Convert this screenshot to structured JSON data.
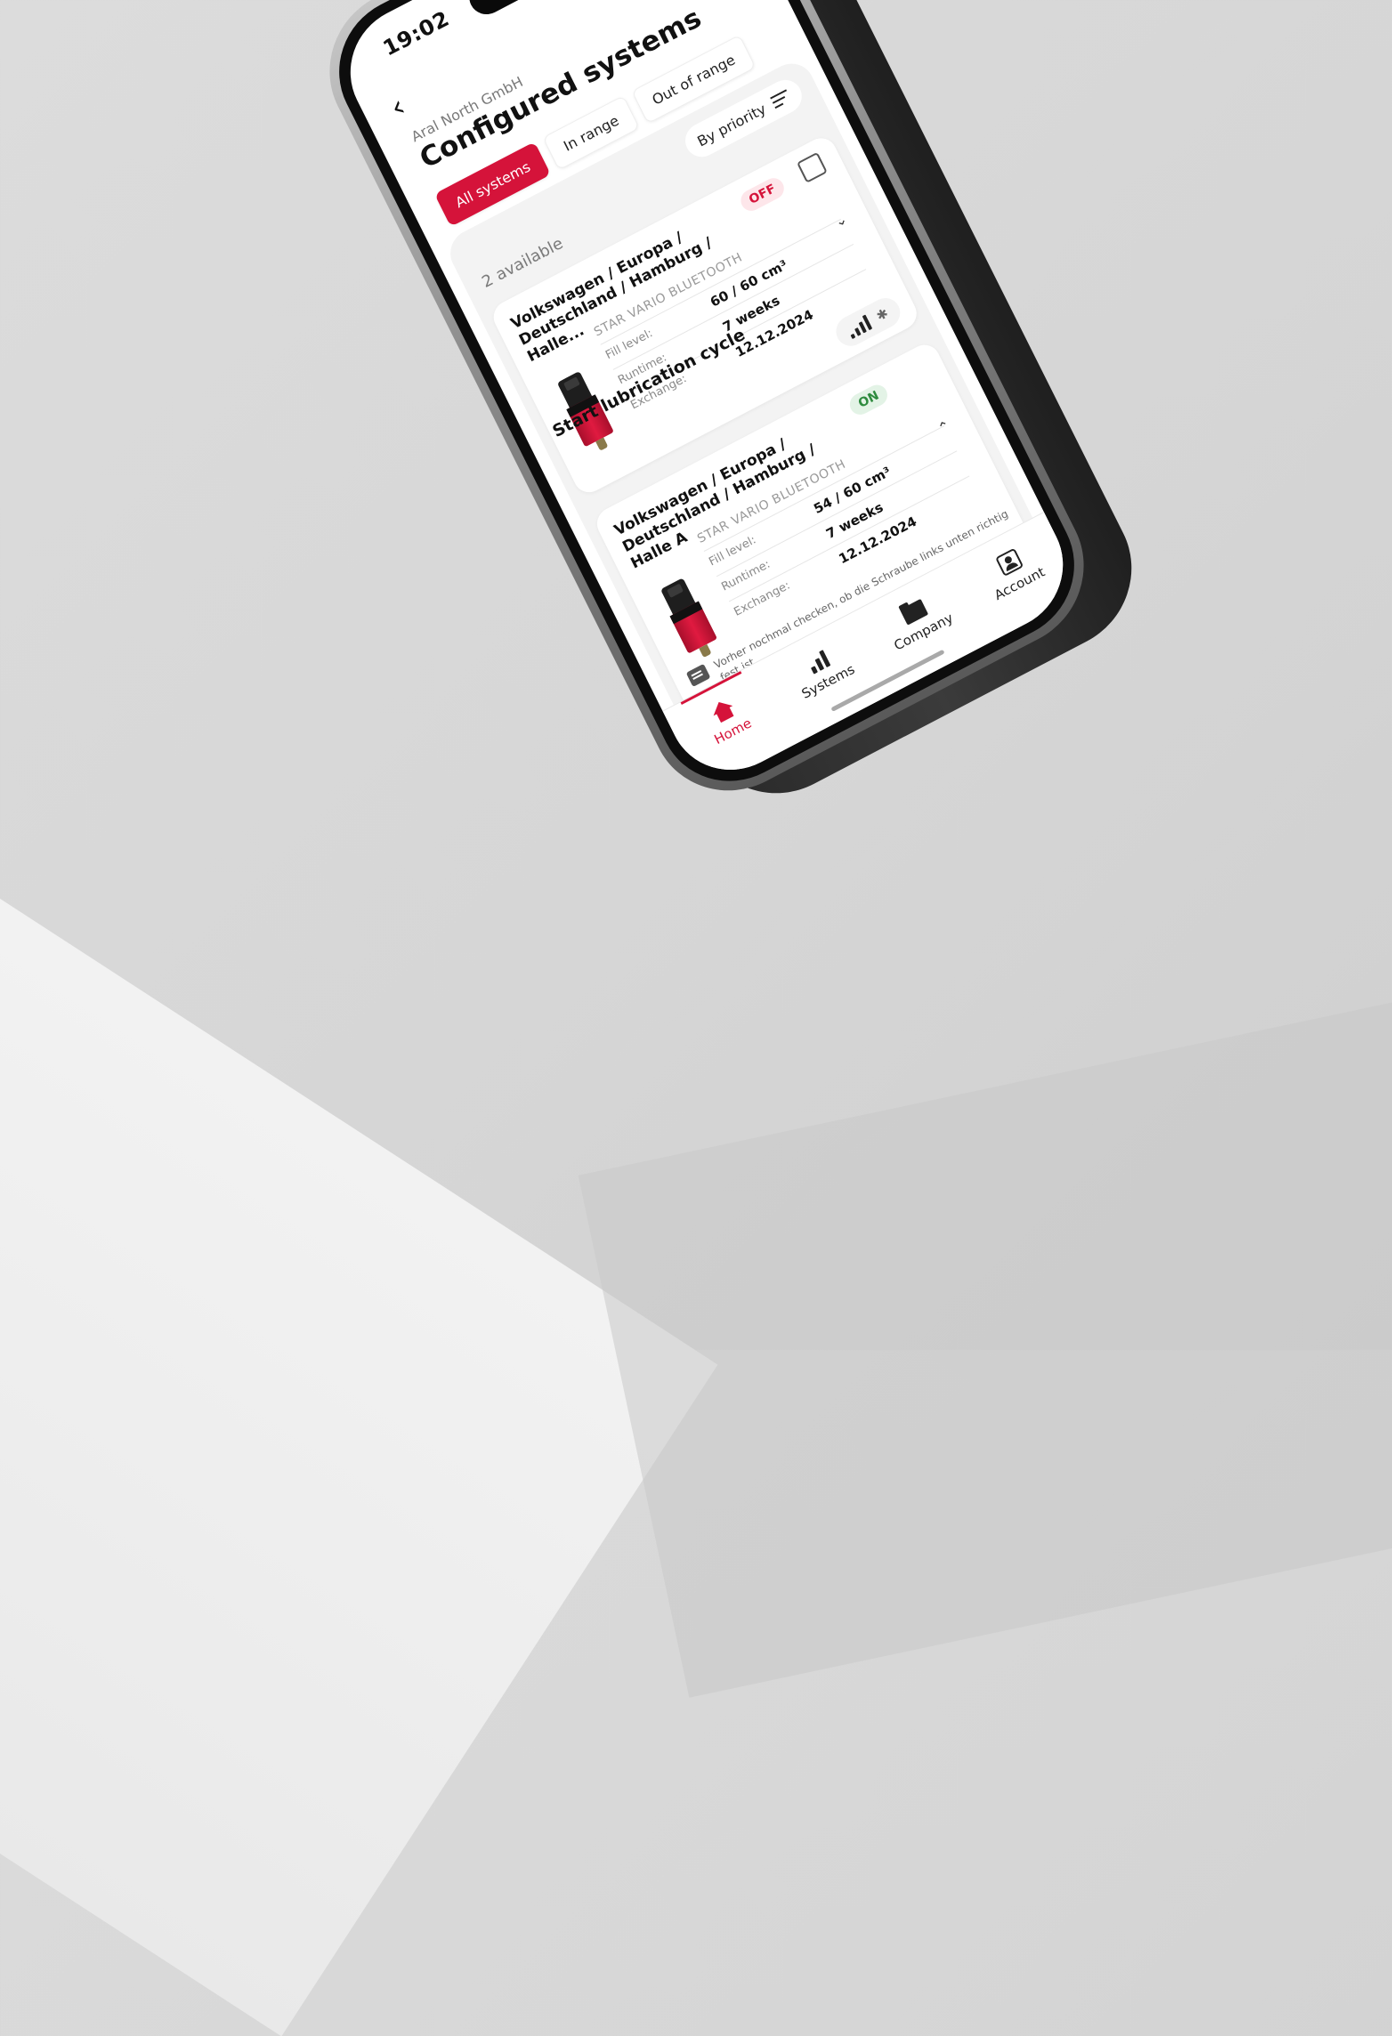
{
  "status_bar": {
    "time": "19:02"
  },
  "header": {
    "back_icon": "chevron-left-icon",
    "company": "Aral North GmbH",
    "title": "Configured systems"
  },
  "filters": [
    {
      "label": "All systems",
      "active": true
    },
    {
      "label": "In range",
      "active": false
    },
    {
      "label": "Out of range",
      "active": false
    }
  ],
  "list": {
    "count_text": "2 available",
    "sort_label": "By priority"
  },
  "systems": [
    {
      "title": "Volkswagen / Europa / Deutschland / Hamburg / Halle...",
      "status": "OFF",
      "model": "STAR VARIO BLUETOOTH",
      "fill_level_label": "Fill level:",
      "fill_level": "60 / 60 cm³",
      "runtime_label": "Runtime:",
      "runtime": "7 weeks",
      "exchange_label": "Exchange:",
      "exchange": "12.12.2024",
      "action_label": "Start lubrication cycle",
      "expanded": false
    },
    {
      "title": "Volkswagen / Europa / Deutschland / Hamburg / Halle A",
      "status": "ON",
      "model": "STAR VARIO BLUETOOTH",
      "fill_level_label": "Fill level:",
      "fill_level": "54 / 60 cm³",
      "runtime_label": "Runtime:",
      "runtime": "7 weeks",
      "exchange_label": "Exchange:",
      "exchange": "12.12.2024",
      "note": "Vorher nochmal checken, ob die Schraube links unten richtig fest ist.",
      "expanded": true
    }
  ],
  "tabbar": [
    {
      "label": "Home",
      "icon": "home-icon",
      "active": true
    },
    {
      "label": "Systems",
      "icon": "bar-chart-icon",
      "active": false
    },
    {
      "label": "Company",
      "icon": "folder-icon",
      "active": false
    },
    {
      "label": "Account",
      "icon": "account-icon",
      "active": false
    }
  ],
  "colors": {
    "accent": "#d5133a",
    "status_on": "#2e8b3e",
    "status_off": "#d5133a"
  }
}
